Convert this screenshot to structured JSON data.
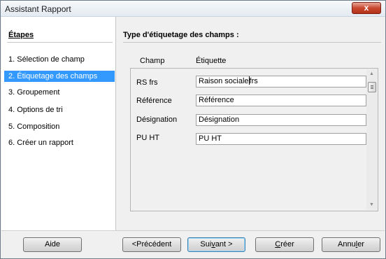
{
  "window": {
    "title": "Assistant Rapport",
    "close_symbol": "x"
  },
  "steps": {
    "heading": "Étapes",
    "items": [
      {
        "label": "1.  Sélection de champ"
      },
      {
        "label": "2.  Étiquetage des champs",
        "selected": true
      },
      {
        "label": "3.  Groupement"
      },
      {
        "label": "4.  Options de tri"
      },
      {
        "label": "5.  Composition"
      },
      {
        "label": "6.  Créer un rapport"
      }
    ]
  },
  "main": {
    "title": "Type d'étiquetage des champs :",
    "column_field": "Champ",
    "column_label": "Étiquette",
    "fields": [
      {
        "name": "RS frs",
        "value_before_cursor": "Raison sociale",
        "value_after_cursor": "frs"
      },
      {
        "name": "Référence",
        "value": "Référence"
      },
      {
        "name": "Désignation",
        "value": "Désignation"
      },
      {
        "name": "PU HT",
        "value": "PU HT"
      }
    ]
  },
  "buttons": {
    "help": "Aide",
    "previous": "<Précédent",
    "next_prefix": "Sui",
    "next_ul": "v",
    "next_suffix": "ant >",
    "create_ul": "C",
    "create_suffix": "réer",
    "cancel_prefix": "Annu",
    "cancel_ul": "l",
    "cancel_suffix": "er"
  }
}
